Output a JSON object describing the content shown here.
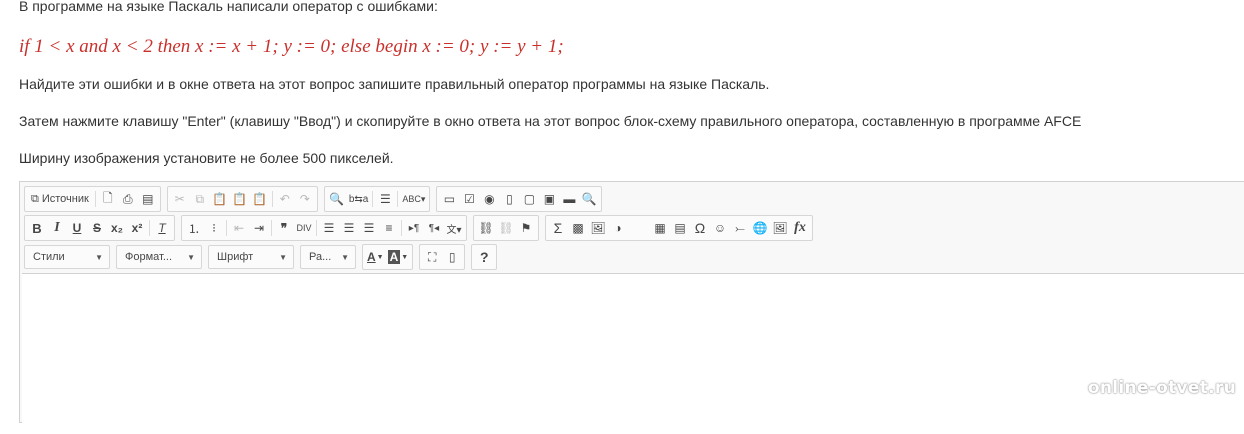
{
  "question": {
    "intro": "В программе на языке Паскаль написали оператор с ошибками:",
    "code": "if 1 < x  and x < 2 then  x := x + 1; y := 0; else begin x := 0; y := y + 1;",
    "find_errors": "Найдите эти ошибки и в окне ответа на этот вопрос запишите правильный оператор программы на языке Паскаль.",
    "then_instruction": "Затем нажмите клавишу \"Enter\" (клавишу \"Ввод\") и скопируйте в окно ответа на этот вопрос блок-схему правильного оператора, составленную в программе AFCE",
    "width_instruction": "Ширину изображения установите не более 500 пикселей."
  },
  "editor": {
    "source_label": "Источник",
    "styles_label": "Стили",
    "format_label": "Формат...",
    "font_label": "Шрифт",
    "size_label": "Ра...",
    "help_label": "?",
    "text_color_label": "A",
    "bg_color_label": "A"
  },
  "watermark": "online-otvet.ru"
}
